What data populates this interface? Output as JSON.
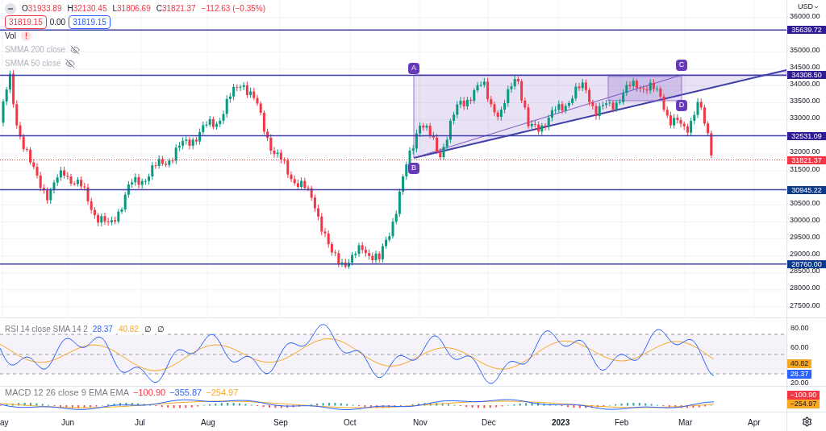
{
  "legend": {
    "ohlc": [
      {
        "key": "O",
        "value": "31933.89"
      },
      {
        "key": "H",
        "value": "32130.45"
      },
      {
        "key": "L",
        "value": "31806.69"
      },
      {
        "key": "C",
        "value": "31821.37"
      }
    ],
    "change": "−112.63 (−0.35%)",
    "bid": "31819.15",
    "spread": "0.00",
    "ask": "31819.15",
    "indicators": [
      {
        "label": "Vol",
        "kind": "warning"
      },
      {
        "label": "SMMA 200 close",
        "kind": "hidden"
      },
      {
        "label": "SMMA 50 close",
        "kind": "hidden"
      }
    ]
  },
  "price_axis": {
    "currency": "USD",
    "ticks": [
      "36000.00",
      "35000.00",
      "34500.00",
      "34000.00",
      "33500.00",
      "33000.00",
      "32000.00",
      "31500.00",
      "30500.00",
      "30000.00",
      "29500.00",
      "29000.00",
      "28500.00",
      "28000.00",
      "27500.00"
    ],
    "levels": [
      {
        "value": "35639.72",
        "kind": "level",
        "color": "#311b92"
      },
      {
        "value": "34308.50",
        "kind": "level",
        "color": "#311b92"
      },
      {
        "value": "32531.09",
        "kind": "level",
        "color": "#311b92"
      },
      {
        "value": "31821.37",
        "kind": "last",
        "color": "#f23645"
      },
      {
        "value": "30945.22",
        "kind": "level",
        "color": "#0d3a8a"
      },
      {
        "value": "28760.00",
        "kind": "level",
        "color": "#0d3a8a"
      }
    ]
  },
  "drawings": {
    "points": [
      "A",
      "B",
      "C",
      "D"
    ]
  },
  "rsi": {
    "title": "RSI 14 close SMA 14 2",
    "values": [
      {
        "text": "28.37",
        "color": "#2962ff"
      },
      {
        "text": "40.82",
        "color": "#f9a825"
      },
      {
        "text": "∅"
      },
      {
        "text": "∅"
      }
    ],
    "ticks": [
      "80.00",
      "60.00",
      "20.00"
    ],
    "badges": [
      {
        "value": "40.82",
        "color": "#f9a825"
      },
      {
        "value": "28.37",
        "color": "#2962ff"
      }
    ]
  },
  "macd": {
    "title": "MACD 12 26 close 9 EMA EMA",
    "values": [
      {
        "text": "−100.90",
        "color": "#f23645"
      },
      {
        "text": "−355.87",
        "color": "#2962ff"
      },
      {
        "text": "−254.97",
        "color": "#f9a825"
      }
    ],
    "badges": [
      {
        "value": "−100.90",
        "color": "#f23645"
      },
      {
        "value": "−254.97",
        "color": "#f9a825"
      }
    ]
  },
  "time_axis": {
    "labels": [
      {
        "text": "ay",
        "bold": false
      },
      {
        "text": "Jun",
        "bold": false
      },
      {
        "text": "Jul",
        "bold": false
      },
      {
        "text": "Aug",
        "bold": false
      },
      {
        "text": "Sep",
        "bold": false
      },
      {
        "text": "Oct",
        "bold": false
      },
      {
        "text": "Nov",
        "bold": false
      },
      {
        "text": "Dec",
        "bold": false
      },
      {
        "text": "2023",
        "bold": true
      },
      {
        "text": "Feb",
        "bold": false
      },
      {
        "text": "Mar",
        "bold": false
      },
      {
        "text": "Apr",
        "bold": false
      }
    ]
  }
}
